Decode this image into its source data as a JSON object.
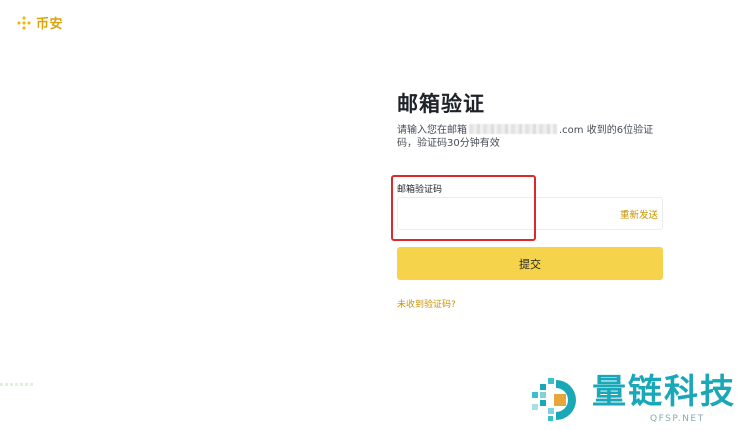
{
  "header": {
    "logo_text": "币安",
    "logo_icon": "binance-diamond-icon",
    "brand_color": "#F0B90B"
  },
  "verify": {
    "title": "邮箱验证",
    "desc_prefix": "请输入您在邮箱",
    "desc_suffix": ".com 收到的6位验证码，验证码30分钟有效",
    "field_label": "邮箱验证码",
    "input_value": "",
    "resend_label": "重新发送",
    "submit_label": "提交",
    "no_code_link": "未收到验证码?"
  },
  "watermark": {
    "text": "量链科技",
    "sub": "QFSP.NET",
    "color": "#1AA8B8"
  },
  "colors": {
    "accent": "#C99400",
    "button": "#F5D34A",
    "highlight": "#D92B2B"
  }
}
